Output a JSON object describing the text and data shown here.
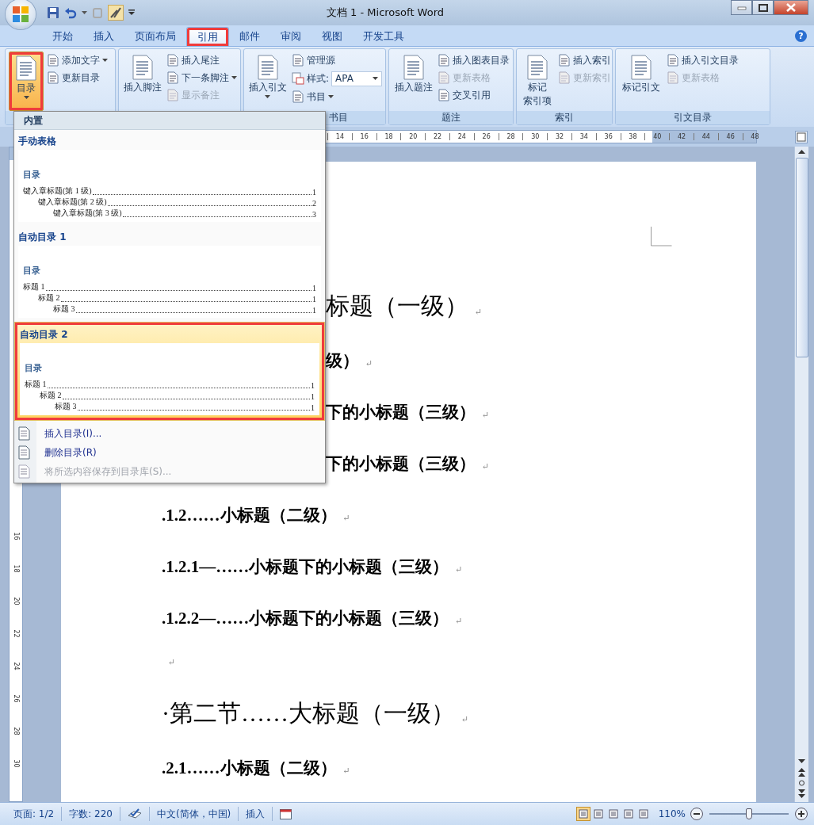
{
  "window": {
    "title": "文档 1 - Microsoft Word"
  },
  "tabs": [
    {
      "label": "开始",
      "selected": false,
      "highlighted": false
    },
    {
      "label": "插入",
      "selected": false,
      "highlighted": false
    },
    {
      "label": "页面布局",
      "selected": false,
      "highlighted": false
    },
    {
      "label": "引用",
      "selected": true,
      "highlighted": true
    },
    {
      "label": "邮件",
      "selected": false,
      "highlighted": false
    },
    {
      "label": "审阅",
      "selected": false,
      "highlighted": false
    },
    {
      "label": "视图",
      "selected": false,
      "highlighted": false
    },
    {
      "label": "开发工具",
      "selected": false,
      "highlighted": false
    }
  ],
  "help": "?",
  "ribbon": {
    "groups": [
      {
        "items": [
          {
            "kind": "large",
            "label": "目录",
            "dropdown": true,
            "disabled": false,
            "pressed": true,
            "highlighted": true
          },
          {
            "kind": "small",
            "label": "添加文字",
            "dropdown": true,
            "disabled": false,
            "pressed": false,
            "highlighted": false
          },
          {
            "kind": "small",
            "label": "更新目录",
            "dropdown": false,
            "disabled": false,
            "pressed": false,
            "highlighted": false
          }
        ]
      },
      {
        "items": [
          {
            "kind": "large",
            "label": "插入脚注",
            "dropdown": false,
            "disabled": false,
            "pressed": false,
            "highlighted": false
          },
          {
            "kind": "small",
            "label": "插入尾注",
            "dropdown": false,
            "disabled": false,
            "pressed": false,
            "highlighted": false
          },
          {
            "kind": "small",
            "label": "下一条脚注",
            "dropdown": true,
            "disabled": false,
            "pressed": false,
            "highlighted": false
          },
          {
            "kind": "small",
            "label": "显示备注",
            "dropdown": false,
            "disabled": true,
            "pressed": false,
            "highlighted": false
          }
        ]
      },
      {
        "label": "书目",
        "items": [
          {
            "kind": "large",
            "label": "插入引文",
            "dropdown": true,
            "disabled": false,
            "pressed": false,
            "highlighted": false
          },
          {
            "kind": "small",
            "label": "管理源",
            "dropdown": false,
            "disabled": false,
            "pressed": false,
            "highlighted": false
          },
          {
            "kind": "combo",
            "label": "样式:",
            "value": "APA",
            "dropdown": true,
            "disabled": false,
            "pressed": false,
            "highlighted": false
          },
          {
            "kind": "small",
            "label": "书目",
            "dropdown": true,
            "disabled": false,
            "pressed": false,
            "highlighted": false
          }
        ]
      },
      {
        "label": "题注",
        "items": [
          {
            "kind": "large",
            "label": "插入题注",
            "dropdown": false,
            "disabled": false,
            "pressed": false,
            "highlighted": false
          },
          {
            "kind": "small",
            "label": "插入图表目录",
            "dropdown": false,
            "disabled": false,
            "pressed": false,
            "highlighted": false
          },
          {
            "kind": "small",
            "label": "更新表格",
            "dropdown": false,
            "disabled": true,
            "pressed": false,
            "highlighted": false
          },
          {
            "kind": "small",
            "label": "交叉引用",
            "dropdown": false,
            "disabled": false,
            "pressed": false,
            "highlighted": false
          }
        ]
      },
      {
        "label": "索引",
        "items": [
          {
            "kind": "large",
            "label": "标记",
            "label_2": "索引项",
            "dropdown": false,
            "disabled": false,
            "pressed": false,
            "highlighted": false
          },
          {
            "kind": "small",
            "label": "插入索引",
            "dropdown": false,
            "disabled": false,
            "pressed": false,
            "highlighted": false
          },
          {
            "kind": "small",
            "label": "更新索引",
            "dropdown": false,
            "disabled": true,
            "pressed": false,
            "highlighted": false
          }
        ]
      },
      {
        "label": "引文目录",
        "items": [
          {
            "kind": "large",
            "label": "标记引文",
            "dropdown": false,
            "disabled": false,
            "pressed": false,
            "highlighted": false
          },
          {
            "kind": "small",
            "label": "插入引文目录",
            "dropdown": false,
            "disabled": false,
            "pressed": false,
            "highlighted": false
          },
          {
            "kind": "small",
            "label": "更新表格",
            "dropdown": false,
            "disabled": true,
            "pressed": false,
            "highlighted": false
          }
        ]
      }
    ]
  },
  "ruler": {
    "numbers": [
      "14",
      "16",
      "18",
      "20",
      "22",
      "24",
      "26",
      "28",
      "30",
      "32",
      "34",
      "36",
      "38",
      "40",
      "42",
      "44",
      "46",
      "48"
    ],
    "side_numbers": [
      "16",
      "18",
      "20",
      "22",
      "24",
      "26",
      "28",
      "30"
    ]
  },
  "toc_menu": {
    "header": "内置",
    "gallery": [
      {
        "title": "手动表格",
        "selected": false,
        "highlighted": false,
        "preview": {
          "heading": "目录",
          "entries": [
            {
              "text": "键入章标题(第 1 级)",
              "page": "1",
              "children": [
                {
                  "text": "键入章标题(第 2 级)",
                  "page": "2",
                  "children": [
                    {
                      "text": "键入章标题(第 3 级)",
                      "page": "3"
                    }
                  ]
                }
              ]
            }
          ]
        }
      },
      {
        "title": "自动目录 1",
        "selected": false,
        "highlighted": false,
        "preview": {
          "heading": "目录",
          "entries": [
            {
              "text": "标题 1",
              "page": "1",
              "children": [
                {
                  "text": "标题 2",
                  "page": "1",
                  "children": [
                    {
                      "text": "标题 3",
                      "page": "1"
                    }
                  ]
                }
              ]
            }
          ]
        }
      },
      {
        "title": "自动目录 2",
        "selected": true,
        "highlighted": true,
        "preview": {
          "heading": "目录",
          "entries": [
            {
              "text": "标题 1",
              "page": "1",
              "children": [
                {
                  "text": "标题 2",
                  "page": "1",
                  "children": [
                    {
                      "text": "标题 3",
                      "page": "1"
                    }
                  ]
                }
              ]
            }
          ]
        }
      }
    ],
    "commands": [
      {
        "label": "插入目录(I)...",
        "disabled": false
      },
      {
        "label": "删除目录(R)",
        "disabled": false
      },
      {
        "label": "将所选内容保存到目录库(S)...",
        "disabled": true
      }
    ]
  },
  "document": {
    "lines": [
      {
        "kind": "h1",
        "text": "标题（一级）",
        "mark": "↵",
        "partly_hidden": true
      },
      {
        "kind": "h2",
        "text": "级）",
        "mark": "↵",
        "partly_hidden": true
      },
      {
        "kind": "h3",
        "text": "下的小标题（三级）",
        "mark": "↵",
        "partly_hidden": true
      },
      {
        "kind": "h3",
        "text": "下的小标题（三级）",
        "mark": "↵",
        "partly_hidden": true
      },
      {
        "kind": "h2",
        "text": ".1.2……小标题（二级）",
        "mark": "↵",
        "partly_hidden": false
      },
      {
        "kind": "h3",
        "text": ".1.2.1—……小标题下的小标题（三级）",
        "mark": "↵",
        "partly_hidden": false
      },
      {
        "kind": "h3",
        "text": ".1.2.2—……小标题下的小标题（三级）",
        "mark": "↵",
        "partly_hidden": false
      },
      {
        "kind": "empty",
        "mark": "↵",
        "partly_hidden": false
      },
      {
        "kind": "h1",
        "text": "·第二节……大标题（一级）",
        "mark": "↵",
        "partly_hidden": false
      },
      {
        "kind": "h2",
        "text": ".2.1……小标题（二级）",
        "mark": "↵",
        "partly_hidden": false
      }
    ]
  },
  "status_bar": {
    "page": "页面: 1/2",
    "words": "字数: 220",
    "language": "中文(简体，中国)",
    "mode": "插入",
    "views": [
      {
        "selected": true
      },
      {
        "selected": false
      },
      {
        "selected": false
      },
      {
        "selected": false
      },
      {
        "selected": false
      }
    ],
    "zoom": "110%",
    "zoom_slider": {
      "level": 0.5
    }
  }
}
